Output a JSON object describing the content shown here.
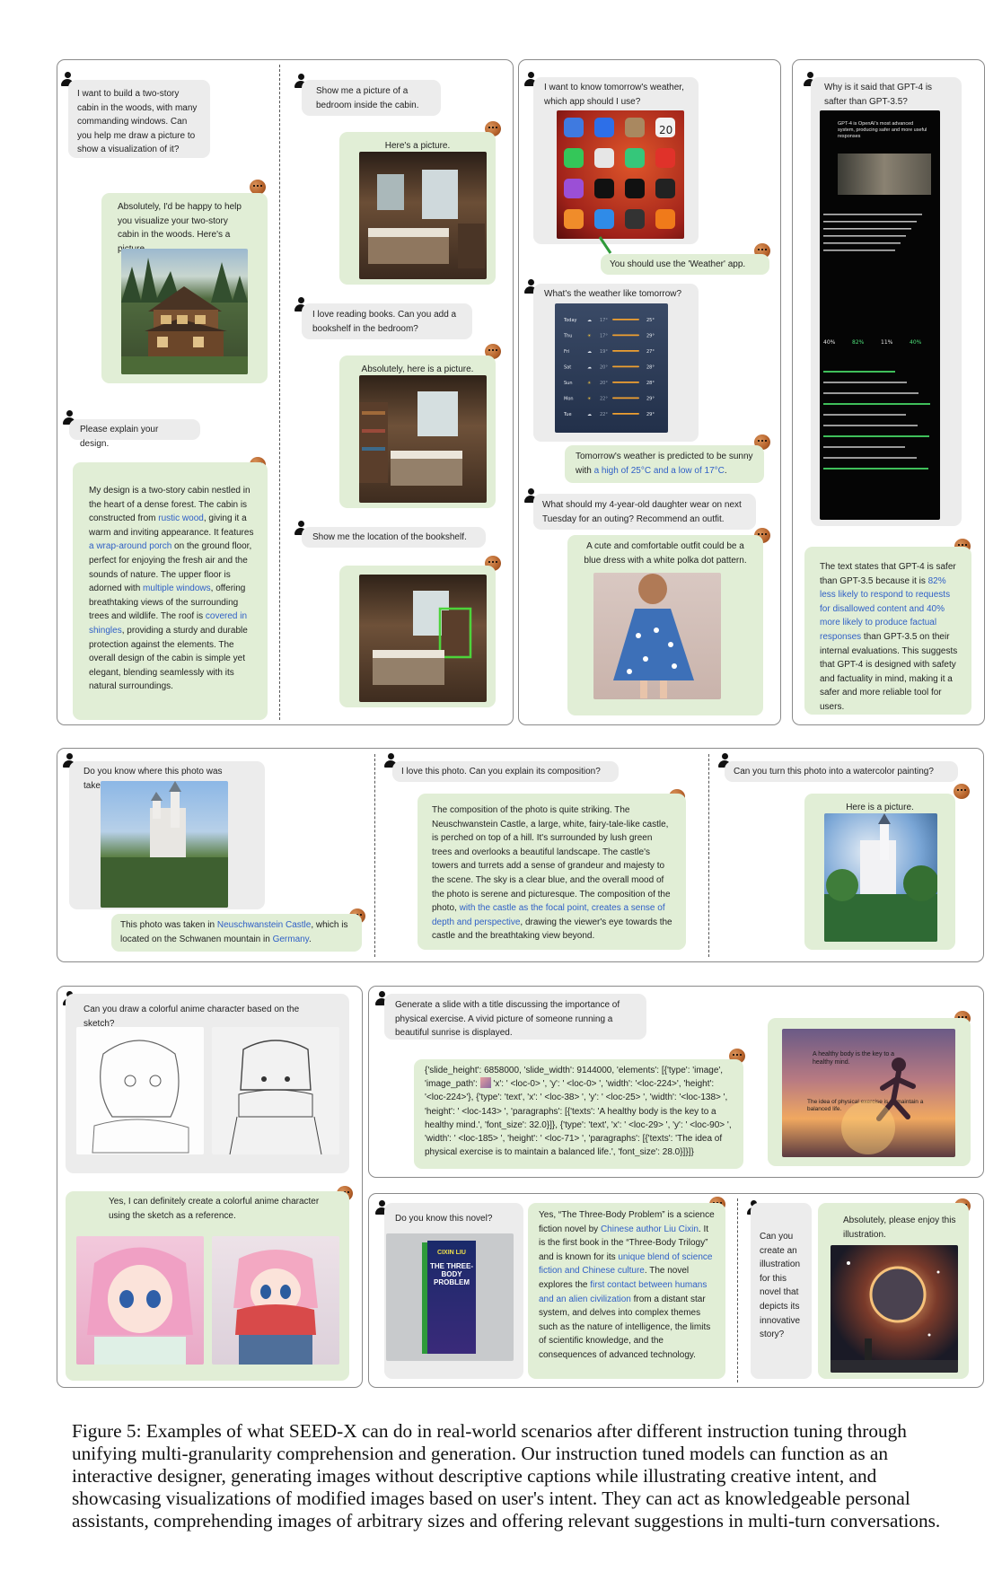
{
  "panel1": {
    "left_turn1_user": "I want to build a two-story cabin in the woods, with many commanding windows. Can you help me draw a picture to show a visualization of it?",
    "left_turn1_bot": "Absolutely, I'd be happy to help you visualize your two-story cabin in the woods. Here's a picture.",
    "left_turn2_user": "Please explain your design.",
    "left_turn2_bot_parts": [
      "My design is a two-story cabin nestled in the heart of a dense forest. The cabin is constructed from ",
      "rustic wood",
      ", giving it a warm and inviting appearance. It features ",
      "a wrap-around porch",
      " on the ground floor, perfect for enjoying the fresh air and the sounds of nature. The upper floor is adorned with ",
      "multiple windows",
      ", offering breathtaking views of the surrounding trees and wildlife. The roof is ",
      "covered in shingles",
      ", providing a sturdy and durable protection against the elements. The overall design of the cabin is simple yet elegant, blending seamlessly with its natural surroundings."
    ],
    "right_turn1_user": "Show me a picture of a bedroom inside the cabin.",
    "right_turn1_bot": "Here's a picture.",
    "right_turn2_user": "I love reading books. Can you add a bookshelf in the bedroom?",
    "right_turn2_bot": "Absolutely, here is a picture.",
    "right_turn3_user": "Show me the location of the bookshelf."
  },
  "panel2": {
    "turn1_user": "I want to know tomorrow's weather, which app should I use?",
    "turn1_bot": "You should use the 'Weather' app.",
    "calendar_day": "20",
    "turn2_user": "What's the weather like tomorrow?",
    "weather_rows": [
      {
        "day": "Today",
        "low": "17°",
        "high": "25°",
        "icon": "☁"
      },
      {
        "day": "Thu",
        "low": "17°",
        "high": "29°",
        "icon": "☀"
      },
      {
        "day": "Fri",
        "low": "19°",
        "high": "27°",
        "icon": "☁"
      },
      {
        "day": "Sat",
        "low": "20°",
        "high": "28°",
        "icon": "☁"
      },
      {
        "day": "Sun",
        "low": "20°",
        "high": "28°",
        "icon": "☀"
      },
      {
        "day": "Mon",
        "low": "22°",
        "high": "29°",
        "icon": "☀"
      },
      {
        "day": "Tue",
        "low": "22°",
        "high": "29°",
        "icon": "☁"
      }
    ],
    "turn2_bot_prefix": "Tomorrow's weather is predicted to be sunny with ",
    "turn2_bot_highlight": "a high of 25°C and a low of 17°C",
    "turn2_bot_suffix": ".",
    "turn3_user": "What should my 4-year-old daughter wear on next Tuesday for an outing? Recommend an outfit.",
    "turn3_bot": "A cute and comfortable outfit could be a blue dress with a white polka dot pattern."
  },
  "panel3": {
    "user": "Why is it said that GPT-4 is safter than GPT-3.5?",
    "doc_heading": "GPT-4 is OpenAI's most advanced system, producing safer and more useful responses",
    "doc_stats": [
      "40%",
      "82%",
      "11%",
      "40%"
    ],
    "bot_prefix": "The text states that GPT-4 is safer than GPT-3.5 because it is ",
    "bot_highlight": "82% less likely to respond to requests for disallowed content and 40% more likely to produce factual responses",
    "bot_suffix": " than GPT-3.5 on their internal evaluations. This suggests that GPT-4 is designed with safety and factuality in mind, making it a safer and more reliable tool for users."
  },
  "panel4": {
    "turn1_user": "Do you know where this photo was taken?",
    "turn1_bot_parts": [
      "This photo was taken in ",
      "Neuschwanstein Castle",
      ", which is located on the Schwanen mountain in ",
      "Germany",
      "."
    ],
    "turn2_user": "I love this photo. Can you explain its composition?",
    "turn2_bot_parts": [
      "The composition of the photo is quite striking. The Neuschwanstein Castle, a large, white, fairy-tale-like castle, is perched on top of a hill. It's surrounded by lush green trees and overlooks a beautiful landscape. The castle's towers and turrets add a sense of grandeur and majesty to the scene. The sky is a clear blue, and the overall mood of the photo is serene and picturesque. The composition of the photo, ",
      "with the castle as the focal point, creates a sense of depth and perspective",
      ", drawing the viewer's eye towards the castle and the breathtaking view beyond."
    ],
    "turn3_user": "Can you turn this photo into a watercolor painting?",
    "turn3_bot": "Here is a picture."
  },
  "panel5": {
    "user": "Can you draw a colorful anime character based on the sketch?",
    "bot": "Yes, I can definitely create a colorful anime character using the sketch as a reference."
  },
  "panel6": {
    "user": "Generate a slide with a title discussing the importance of physical exercise. A vivid picture of someone running a beautiful sunrise is displayed.",
    "code_before_icon": "{'slide_height': 6858000, 'slide_width': 9144000, 'elements': [{'type': 'image', 'image_path': ",
    "code_after_icon": " 'x': ' <loc-0> ', 'y': ' <loc-0> ', 'width': '<loc-224>', 'height': '<loc-224>'}, {'type': 'text', 'x': ' <loc-38> ', 'y': ' <loc-25> ', 'width': '<loc-138> ', 'height': ' <loc-143> ', 'paragraphs': [{'texts': 'A healthy body is the key to a healthy mind.', 'font_size': 32.0}]}, {'type': 'text', 'x': ' <loc-29> ', 'y': ' <loc-90> ', 'width': ' <loc-185> ', 'height': ' <loc-71> ', 'paragraphs': [{'texts': 'The idea of physical exercise is to maintain a balanced life.', 'font_size': 28.0}]}]}",
    "slide_title": "A healthy body is the key to a healthy mind.",
    "slide_sub": "The idea of physical exercise is to maintain a balanced life."
  },
  "panel7": {
    "turn1_user": "Do you know this novel?",
    "book_author": "CIXIN LIU",
    "book_title": "THE THREE-BODY PROBLEM",
    "turn1_bot_parts": [
      "Yes, “The Three-Body Problem” is a science fiction novel by ",
      "Chinese author Liu Cixin",
      ". It is the first book in the “Three-Body Trilogy” and is known for its ",
      "unique blend of science fiction and Chinese culture",
      ". The novel explores the ",
      "first contact between humans and an alien civilization",
      " from a distant star system, and delves into complex themes such as the nature of intelligence, the limits of scientific knowledge, and the consequences of advanced technology."
    ],
    "turn2_user": "Can you create an illustration for this novel that depicts its innovative story?",
    "turn2_bot": "Absolutely, please enjoy this illustration."
  },
  "caption": {
    "label": "Figure 5:",
    "text": "Examples of what SEED-X can do in real-world scenarios after different instruction tuning through unifying multi-granularity comprehension and generation. Our instruction tuned models can function as an interactive designer, generating images without descriptive captions while illustrating creative intent, and showcasing visualizations of modified images based on user's intent. They can act as knowledgeable personal assistants, comprehending images of arbitrary sizes and offering relevant suggestions in multi-turn conversations."
  }
}
